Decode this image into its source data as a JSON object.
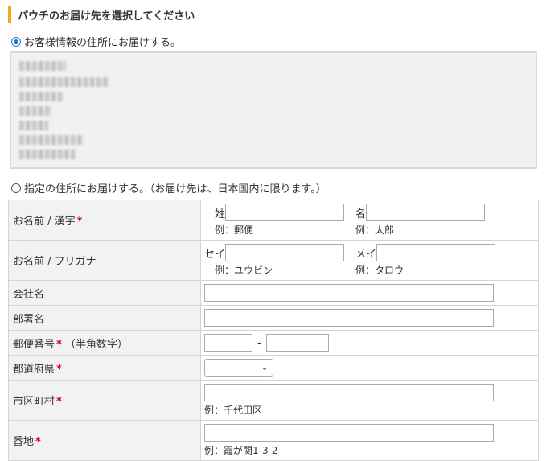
{
  "section": {
    "title": "パウチのお届け先を選択してください"
  },
  "options": {
    "customer_address": "お客様情報の住所にお届けする。",
    "specified_address": "指定の住所にお届けする。（お届け先は、日本国内に限ります。）"
  },
  "form": {
    "name_kanji": {
      "label": "お名前 / 漢字",
      "sei_prefix": "姓",
      "mei_prefix": "名",
      "sei_example": "例：郵便",
      "mei_example": "例：太郎"
    },
    "name_kana": {
      "label": "お名前 / フリガナ",
      "sei_prefix": "セイ",
      "mei_prefix": "メイ",
      "sei_example": "例：ユウビン",
      "mei_example": "例：タロウ"
    },
    "company": {
      "label": "会社名"
    },
    "department": {
      "label": "部署名"
    },
    "postal": {
      "label": "郵便番号",
      "note": "（半角数字）",
      "separator": "-"
    },
    "prefecture": {
      "label": "都道府県"
    },
    "city": {
      "label": "市区町村",
      "example": "例：千代田区"
    },
    "street": {
      "label": "番地",
      "example": "例：霞が関1-3-2"
    },
    "required_mark": "*"
  }
}
